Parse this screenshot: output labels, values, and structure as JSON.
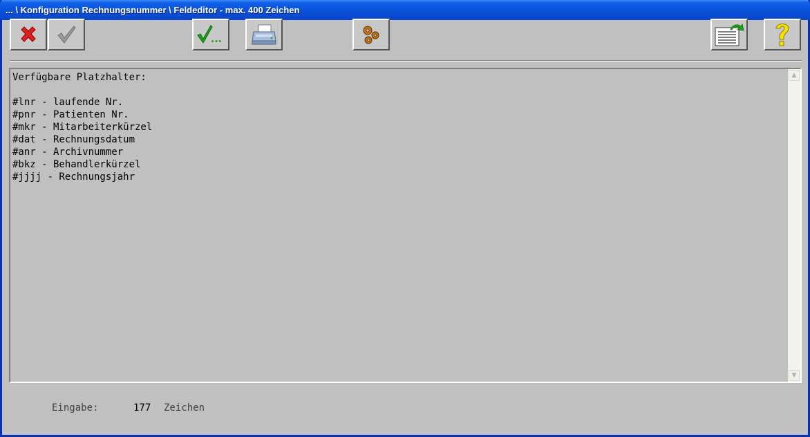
{
  "window": {
    "title": "... \\ Konfiguration Rechnungsnummer \\ Feldeditor - max. 400 Zeichen"
  },
  "toolbar": {
    "buttons": [
      {
        "name": "cancel",
        "icon": "red-x-icon"
      },
      {
        "name": "ok",
        "icon": "checkmark-gray-icon"
      },
      {
        "name": "apply-more",
        "icon": "green-check-ellipsis-icon",
        "label": "..."
      },
      {
        "name": "print",
        "icon": "printer-icon"
      },
      {
        "name": "settings",
        "icon": "gears-icon"
      },
      {
        "name": "export",
        "icon": "document-arrow-icon"
      },
      {
        "name": "help",
        "icon": "question-mark-icon"
      }
    ]
  },
  "editor": {
    "lines": [
      "Verfügbare Platzhalter:",
      "",
      "#lnr - laufende Nr.",
      "#pnr - Patienten Nr.",
      "#mkr - Mitarbeiterkürzel",
      "#dat - Rechnungsdatum",
      "#anr - Archivnummer",
      "#bkz - Behandlerkürzel",
      "#jjjj - Rechnungsjahr"
    ]
  },
  "footer": {
    "input_label": "Eingabe:",
    "char_count": "177",
    "unit": "Zeichen"
  },
  "colors": {
    "titlebar": "#0a54dc",
    "window_bg": "#c0c0c0",
    "cancel_red": "#e02020",
    "green_check": "#1ca01c",
    "help_yellow": "#f5e400"
  }
}
